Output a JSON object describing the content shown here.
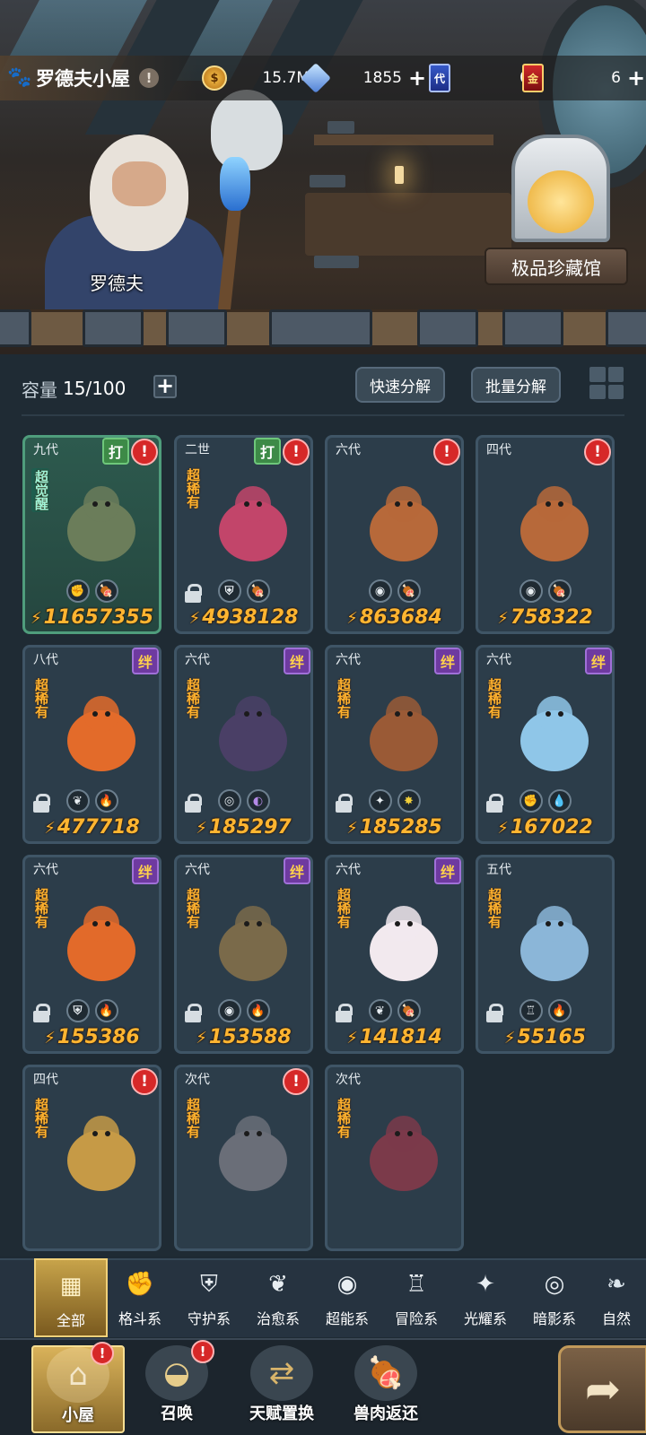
{
  "header": {
    "house_name": "罗德夫小屋",
    "info_icon": "!",
    "resources": [
      {
        "icon": "coin-icon",
        "value": "15.7M",
        "has_plus": false
      },
      {
        "icon": "crystal-icon",
        "value": "1855",
        "has_plus": true
      },
      {
        "icon": "blue-card-icon",
        "label": "代",
        "value": "0",
        "has_plus": false
      },
      {
        "icon": "red-card-icon",
        "label": "金",
        "value": "6",
        "has_plus": true
      }
    ],
    "plus": "+"
  },
  "scene": {
    "npc_name": "罗德夫",
    "museum_label": "极品珍藏馆"
  },
  "toolbar": {
    "capacity_label": "容量",
    "capacity_value": "15/100",
    "add": "+",
    "quick_decompose": "快速分解",
    "batch_decompose": "批量分解"
  },
  "cards": [
    {
      "gen": "九代",
      "rarity": "超觉醒",
      "awaken": true,
      "tags": [
        "打"
      ],
      "alert": true,
      "locked": false,
      "types": [
        "fist-icon",
        "meat-icon"
      ],
      "power": "11657355"
    },
    {
      "gen": "二世",
      "rarity": "超稀有",
      "tags": [
        "打"
      ],
      "alert": true,
      "locked": true,
      "types": [
        "shield-icon",
        "meat-icon"
      ],
      "power": "4938128"
    },
    {
      "gen": "六代",
      "rarity": "",
      "tags": [],
      "alert": true,
      "locked": false,
      "types": [
        "psychic-icon",
        "meat-icon"
      ],
      "power": "863684"
    },
    {
      "gen": "四代",
      "rarity": "",
      "tags": [],
      "alert": true,
      "locked": false,
      "types": [
        "psychic-icon",
        "meat-icon"
      ],
      "power": "758322"
    },
    {
      "gen": "八代",
      "rarity": "超稀有",
      "tags": [
        "绊"
      ],
      "alert": false,
      "locked": true,
      "types": [
        "leaf-icon",
        "fire-icon"
      ],
      "power": "477718"
    },
    {
      "gen": "六代",
      "rarity": "超稀有",
      "tags": [
        "绊"
      ],
      "alert": false,
      "locked": true,
      "types": [
        "eye-icon",
        "moon-icon"
      ],
      "power": "185297"
    },
    {
      "gen": "六代",
      "rarity": "超稀有",
      "tags": [
        "绊"
      ],
      "alert": false,
      "locked": true,
      "types": [
        "star-cross-icon",
        "sun-icon"
      ],
      "power": "185285"
    },
    {
      "gen": "六代",
      "rarity": "超稀有",
      "tags": [
        "绊"
      ],
      "alert": false,
      "locked": true,
      "types": [
        "fist-icon",
        "water-icon"
      ],
      "power": "167022"
    },
    {
      "gen": "六代",
      "rarity": "超稀有",
      "tags": [
        "绊"
      ],
      "alert": false,
      "locked": true,
      "types": [
        "shield-icon",
        "fire-icon"
      ],
      "power": "155386"
    },
    {
      "gen": "六代",
      "rarity": "超稀有",
      "tags": [
        "绊"
      ],
      "alert": false,
      "locked": true,
      "types": [
        "psychic-icon",
        "fire-icon"
      ],
      "power": "153588"
    },
    {
      "gen": "六代",
      "rarity": "超稀有",
      "tags": [
        "绊"
      ],
      "alert": false,
      "locked": true,
      "types": [
        "leaf-icon",
        "meat-icon"
      ],
      "power": "141814"
    },
    {
      "gen": "五代",
      "rarity": "超稀有",
      "tags": [],
      "alert": false,
      "locked": true,
      "types": [
        "tower-icon",
        "fire-icon"
      ],
      "power": "55165"
    },
    {
      "gen": "四代",
      "rarity": "超稀有",
      "tags": [],
      "alert": true,
      "locked": false,
      "types": [],
      "power": ""
    },
    {
      "gen": "次代",
      "rarity": "超稀有",
      "tags": [],
      "alert": true,
      "locked": false,
      "types": [],
      "power": ""
    },
    {
      "gen": "次代",
      "rarity": "超稀有",
      "tags": [],
      "alert": false,
      "locked": false,
      "types": [],
      "power": ""
    }
  ],
  "categories": [
    {
      "label": "全部",
      "icon": "all-icon",
      "active": true
    },
    {
      "label": "格斗系",
      "icon": "fist-icon"
    },
    {
      "label": "守护系",
      "icon": "shield-icon"
    },
    {
      "label": "治愈系",
      "icon": "leaf-icon"
    },
    {
      "label": "超能系",
      "icon": "psychic-icon"
    },
    {
      "label": "冒险系",
      "icon": "tower-icon"
    },
    {
      "label": "光耀系",
      "icon": "star-cross-icon"
    },
    {
      "label": "暗影系",
      "icon": "eye-icon"
    },
    {
      "label": "自然",
      "icon": "nature-icon"
    }
  ],
  "nav": [
    {
      "label": "小屋",
      "icon": "house-icon",
      "active": true,
      "alert": true
    },
    {
      "label": "召唤",
      "icon": "egg-icon",
      "active": false,
      "alert": true
    },
    {
      "label": "天赋置换",
      "icon": "swap-icon",
      "active": false,
      "alert": false
    },
    {
      "label": "兽肉返还",
      "icon": "meat-icon",
      "active": false,
      "alert": false
    }
  ],
  "alert_mark": "!",
  "colors": {
    "power": "#ffb531",
    "rarity": "#ffb22e",
    "alert": "#d62828",
    "accent": "#c7a34a"
  }
}
